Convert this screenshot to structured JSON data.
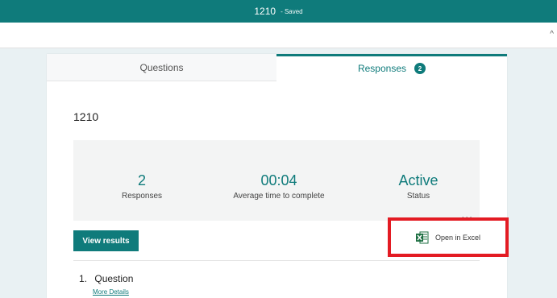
{
  "header": {
    "title": "1210",
    "status": "- Saved"
  },
  "tabs": [
    {
      "label": "Questions"
    },
    {
      "label": "Responses",
      "badge": "2"
    }
  ],
  "form": {
    "title": "1210"
  },
  "stats": [
    {
      "value": "2",
      "label": "Responses"
    },
    {
      "value": "00:04",
      "label": "Average time to complete"
    },
    {
      "value": "Active",
      "label": "Status"
    }
  ],
  "more_menu": "...",
  "actions": {
    "view_results": "View results",
    "open_in_excel": "Open in Excel"
  },
  "questions": [
    {
      "number": "1.",
      "label": "Question",
      "link": "More Details"
    }
  ],
  "colors": {
    "accent": "#0f7b7b",
    "highlight": "#e31b23",
    "excel_green": "#1d6f42"
  }
}
